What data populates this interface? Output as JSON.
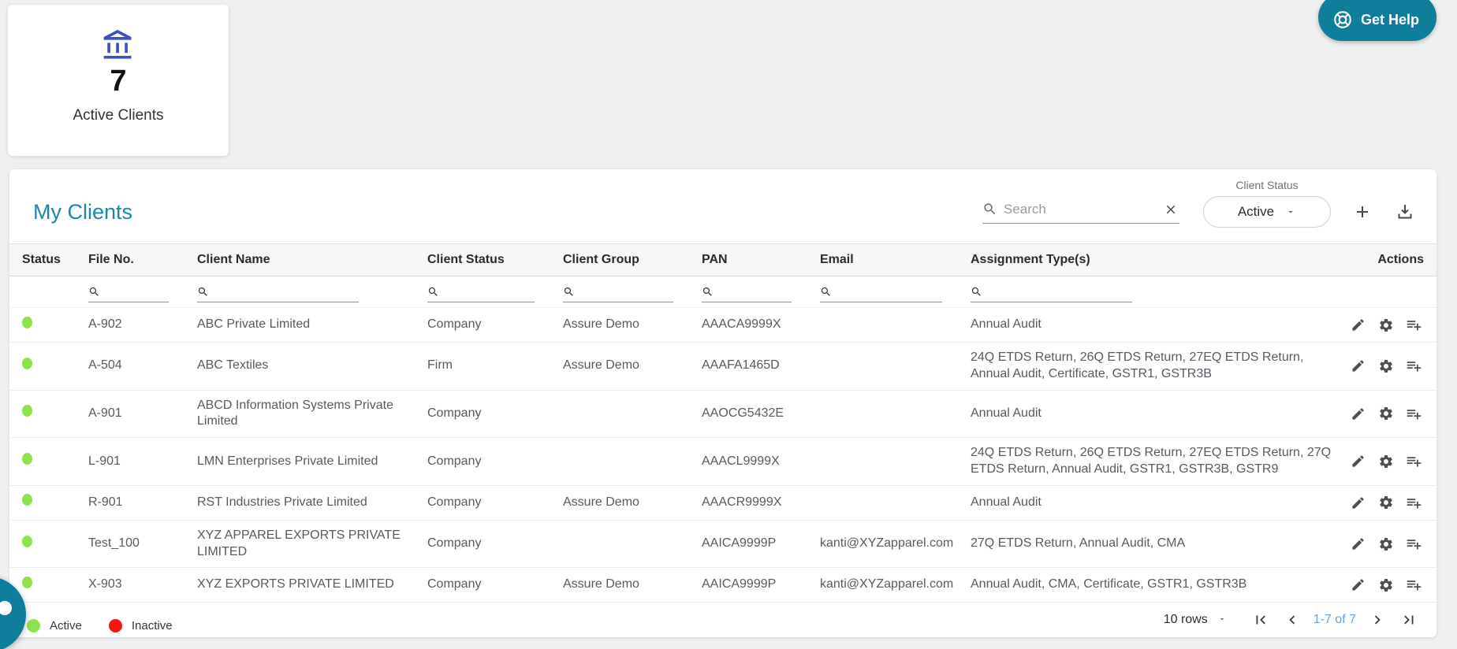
{
  "summary_card": {
    "count": "7",
    "label": "Active Clients"
  },
  "get_help": {
    "label": "Get Help"
  },
  "panel": {
    "title": "My Clients",
    "search_placeholder": "Search",
    "client_status_filter": {
      "label": "Client Status",
      "value": "Active"
    }
  },
  "table": {
    "columns": [
      "Status",
      "File No.",
      "Client Name",
      "Client Status",
      "Client Group",
      "PAN",
      "Email",
      "Assignment Type(s)",
      "Actions"
    ],
    "rows": [
      {
        "status": "active",
        "file_no": "A-902",
        "client_name": "ABC Private Limited",
        "client_status": "Company",
        "client_group": "Assure Demo",
        "pan": "AAACA9999X",
        "email": "",
        "assignments": "Annual Audit"
      },
      {
        "status": "active",
        "file_no": "A-504",
        "client_name": "ABC Textiles",
        "client_status": "Firm",
        "client_group": "Assure Demo",
        "pan": "AAAFA1465D",
        "email": "",
        "assignments": "24Q ETDS Return, 26Q ETDS Return, 27EQ ETDS Return, Annual Audit, Certificate, GSTR1, GSTR3B"
      },
      {
        "status": "active",
        "file_no": "A-901",
        "client_name": "ABCD Information Systems Private Limited",
        "client_status": "Company",
        "client_group": "",
        "pan": "AAOCG5432E",
        "email": "",
        "assignments": "Annual Audit"
      },
      {
        "status": "active",
        "file_no": "L-901",
        "client_name": "LMN Enterprises Private Limited",
        "client_status": "Company",
        "client_group": "",
        "pan": "AAACL9999X",
        "email": "",
        "assignments": "24Q ETDS Return, 26Q ETDS Return, 27EQ ETDS Return, 27Q ETDS Return, Annual Audit, GSTR1, GSTR3B, GSTR9"
      },
      {
        "status": "active",
        "file_no": "R-901",
        "client_name": "RST Industries Private Limited",
        "client_status": "Company",
        "client_group": "Assure Demo",
        "pan": "AAACR9999X",
        "email": "",
        "assignments": "Annual Audit"
      },
      {
        "status": "active",
        "file_no": "Test_100",
        "client_name": "XYZ APPAREL EXPORTS PRIVATE LIMITED",
        "client_status": "Company",
        "client_group": "",
        "pan": "AAICA9999P",
        "email": "kanti@XYZapparel.com",
        "assignments": "27Q ETDS Return, Annual Audit, CMA"
      },
      {
        "status": "active",
        "file_no": "X-903",
        "client_name": "XYZ EXPORTS PRIVATE LIMITED",
        "client_status": "Company",
        "client_group": "Assure Demo",
        "pan": "AAICA9999P",
        "email": "kanti@XYZapparel.com",
        "assignments": "Annual Audit, CMA, Certificate, GSTR1, GSTR3B"
      }
    ]
  },
  "pagination": {
    "rows_per_page": "10 rows",
    "range": "1-7 of 7"
  },
  "legend": {
    "active_label": "Active",
    "inactive_label": "Inactive"
  },
  "colors": {
    "accent_teal": "#0f7e9d",
    "title_blue": "#1a86ad",
    "bank_icon_blue": "#3e4fc1",
    "active_dot": "#8ee24b",
    "inactive_dot": "#f31414",
    "page_range_blue": "#68a3e0"
  }
}
